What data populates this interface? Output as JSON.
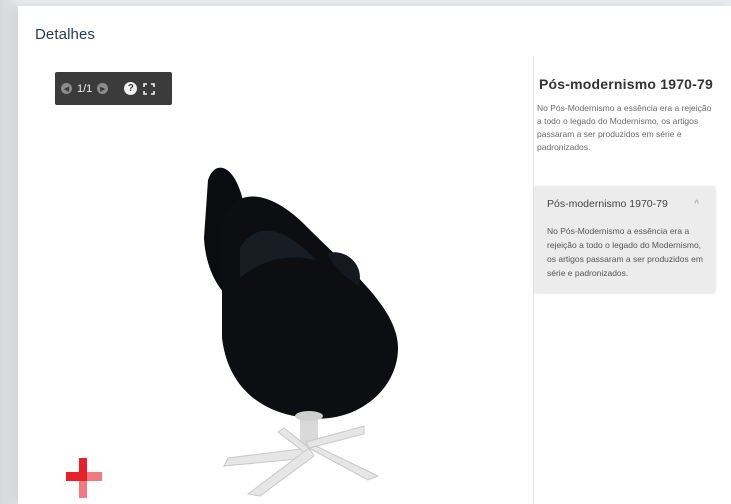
{
  "header": {
    "title": "Detalhes"
  },
  "viewer": {
    "counter": "1/1",
    "help_glyph": "?",
    "icons": [
      "prev-icon",
      "next-icon",
      "help-icon",
      "fullscreen-icon"
    ]
  },
  "panel": {
    "title": "Pós-modernismo 1970-79",
    "description": "No Pós-Modernismo a essência era a rejeição a todo o legado do Modernismo, os artigos passaram a ser produzidos em série e padronizados."
  },
  "accordion": {
    "title": "Pós-modernismo 1970-79",
    "chevron": "^",
    "body": "No Pós-Modernismo a essência era a rejeição a todo o legado do Modernismo, os artigos passaram a ser produzidos em série e padronizados."
  },
  "colors": {
    "toolbar_bg": "#3b3b3b",
    "chair": "#0c0e12",
    "base": "#e6e6e6",
    "logo_red": "#e8202a"
  }
}
